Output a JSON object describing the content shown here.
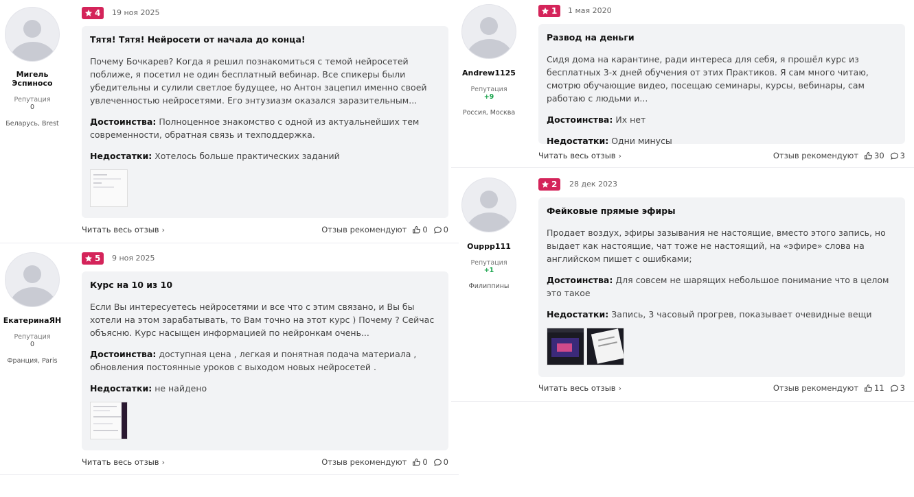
{
  "read_more_label": "Читать весь отзыв",
  "recommend_label": "Отзыв рекомендуют",
  "reputation_label": "Репутация",
  "reviews": [
    {
      "user": {
        "name": "Мигель Эспиносо",
        "reputation": "0",
        "location": "Беларусь, Brest"
      },
      "rating": "4",
      "date": "19 ноя 2025",
      "title": "Тятя! Тятя! Нейросети от начала до конца!",
      "text": "Почему Бочкарев? Когда я решил познакомиться с темой нейросетей поближе, я посетил не один бесплатный вебинар. Все спикеры были убедительны и сулили светлое будущее, но Антон зацепил именно своей увлеченностью нейросетями. Его энтузиазм оказался заразительным...",
      "pros_label": "Достоинства:",
      "pros": "Полноценное знакомство с одной из актуальнейших тем современности, обратная связь и техподдержка.",
      "cons_label": "Недостатки:",
      "cons": "Хотелось больше практических заданий",
      "likes": "0",
      "comments": "0"
    },
    {
      "user": {
        "name": "ЕкатеринаЯН",
        "reputation": "0",
        "location": "Франция, Paris"
      },
      "rating": "5",
      "date": "9 ноя 2025",
      "title": "Курс на 10 из 10",
      "text": "Если Вы интересуетесь нейросетями и все что с этим связано, и Вы бы хотели на этом зарабатывать, то Вам точно на этот курс ) Почему ? Сейчас объясню. Курс насыщен информацией по нейронкам очень...",
      "pros_label": "Достоинства:",
      "pros": "доступная цена , легкая и понятная подача материала , обновления постоянные уроков с выходом новых нейросетей .",
      "cons_label": "Недостатки:",
      "cons": "не найдено",
      "likes": "0",
      "comments": "0"
    },
    {
      "user": {
        "name": "Andrew1125",
        "reputation": "+9",
        "location": "Россия, Москва"
      },
      "rating": "1",
      "date": "1 мая 2020",
      "title": "Развод на деньги",
      "text": "Сидя дома на карантине, ради интереса для себя, я прошёл курс из бесплатных 3-х дней обучения от этих Практиков. Я сам много читаю, смотрю обучающие видео, посещаю семинары, курсы, вебинары, сам работаю с людьми и...",
      "pros_label": "Достоинства:",
      "pros": "Их нет",
      "cons_label": "Недостатки:",
      "cons": "Одни минусы",
      "likes": "30",
      "comments": "3"
    },
    {
      "user": {
        "name": "Ouppp111",
        "reputation": "+1",
        "location": "Филиппины"
      },
      "rating": "2",
      "date": "28 дек 2023",
      "title": "Фейковые прямые эфиры",
      "text": "Продает воздух, эфиры зазывания не настоящие, вместо этого запись, но выдает как настоящие, чат тоже не настоящий, на «эфире» слова на английском пишет с ошибками;",
      "pros_label": "Достоинства:",
      "pros": "Для совсем не шарящих небольшое понимание что в целом это такое",
      "cons_label": "Недостатки:",
      "cons": "Запись, 3 часовый прогрев, показывает очевидные вещи",
      "likes": "11",
      "comments": "3"
    }
  ]
}
